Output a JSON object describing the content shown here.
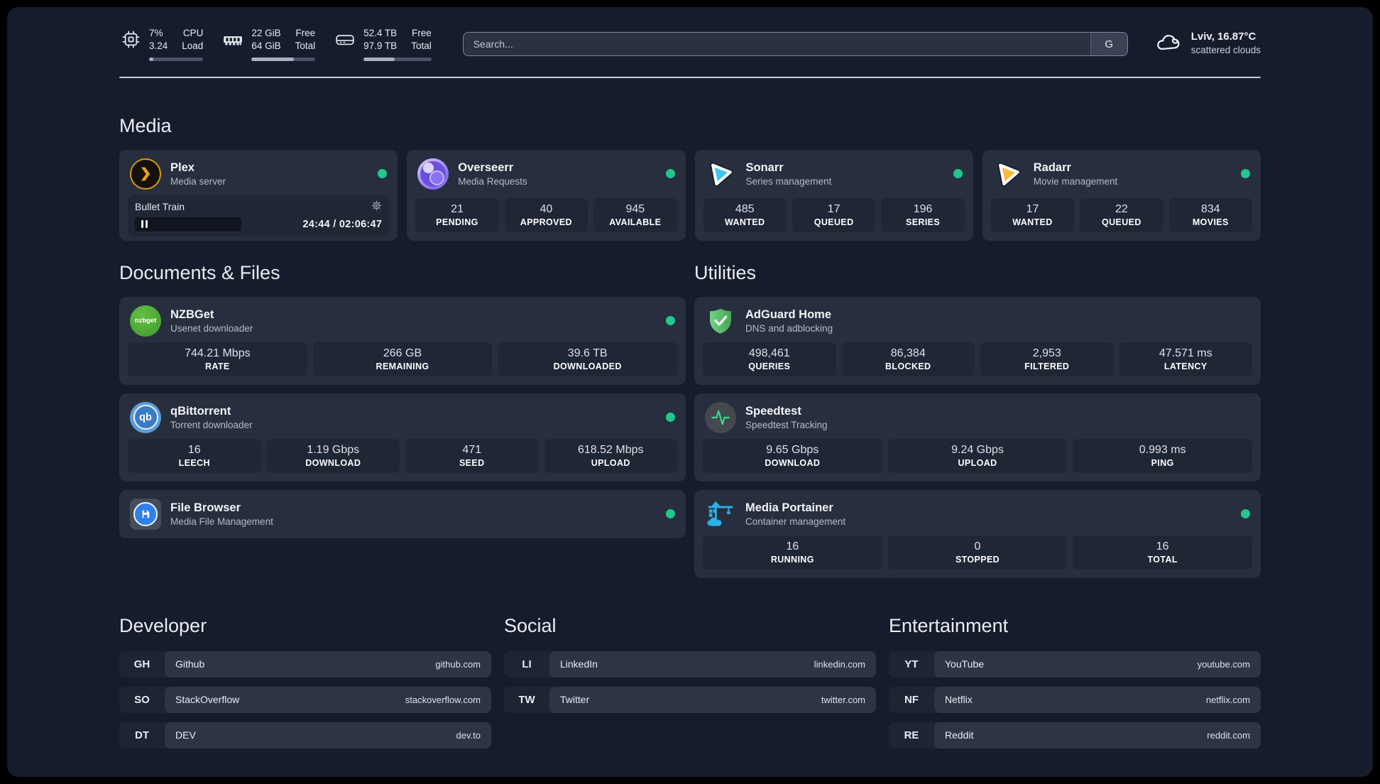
{
  "header": {
    "metrics": [
      {
        "icon": "cpu-chip-icon",
        "values": [
          "7%",
          "3.24"
        ],
        "labels": [
          "CPU",
          "Load"
        ],
        "progress_pct": 8
      },
      {
        "icon": "memory-icon",
        "values": [
          "22 GiB",
          "64 GiB"
        ],
        "labels": [
          "Free",
          "Total"
        ],
        "progress_pct": 66
      },
      {
        "icon": "hard-drive-icon",
        "values": [
          "52.4 TB",
          "97.9 TB"
        ],
        "labels": [
          "Free",
          "Total"
        ],
        "progress_pct": 46
      }
    ],
    "search": {
      "placeholder": "Search...",
      "engine_button": "G"
    },
    "weather": {
      "icon": "cloud-icon",
      "location": "Lviv, 16.87°C",
      "condition": "scattered clouds"
    }
  },
  "media": {
    "title": "Media",
    "cards": [
      {
        "title": "Plex",
        "subtitle": "Media server",
        "icon": "plex-icon",
        "online": true,
        "now_playing": {
          "title": "Bullet Train",
          "time": "24:44 / 02:06:47",
          "state": "paused"
        }
      },
      {
        "title": "Overseerr",
        "subtitle": "Media Requests",
        "icon": "overseerr-icon",
        "online": true,
        "stats": [
          {
            "value": "21",
            "label": "PENDING"
          },
          {
            "value": "40",
            "label": "APPROVED"
          },
          {
            "value": "945",
            "label": "AVAILABLE"
          }
        ]
      },
      {
        "title": "Sonarr",
        "subtitle": "Series management",
        "icon": "sonarr-icon",
        "online": true,
        "stats": [
          {
            "value": "485",
            "label": "WANTED"
          },
          {
            "value": "17",
            "label": "QUEUED"
          },
          {
            "value": "196",
            "label": "SERIES"
          }
        ]
      },
      {
        "title": "Radarr",
        "subtitle": "Movie management",
        "icon": "radarr-icon",
        "online": true,
        "stats": [
          {
            "value": "17",
            "label": "WANTED"
          },
          {
            "value": "22",
            "label": "QUEUED"
          },
          {
            "value": "834",
            "label": "MOVIES"
          }
        ]
      }
    ]
  },
  "documents": {
    "title": "Documents & Files",
    "cards": [
      {
        "title": "NZBGet",
        "subtitle": "Usenet downloader",
        "icon": "nzbget-icon",
        "online": true,
        "stats": [
          {
            "value": "744.21 Mbps",
            "label": "RATE"
          },
          {
            "value": "266 GB",
            "label": "REMAINING"
          },
          {
            "value": "39.6 TB",
            "label": "DOWNLOADED"
          }
        ]
      },
      {
        "title": "qBittorrent",
        "subtitle": "Torrent downloader",
        "icon": "qbittorrent-icon",
        "online": true,
        "stats": [
          {
            "value": "16",
            "label": "LEECH"
          },
          {
            "value": "1.19 Gbps",
            "label": "DOWNLOAD"
          },
          {
            "value": "471",
            "label": "SEED"
          },
          {
            "value": "618.52 Mbps",
            "label": "UPLOAD"
          }
        ]
      },
      {
        "title": "File Browser",
        "subtitle": "Media File Management",
        "icon": "filebrowser-icon",
        "online": true
      }
    ]
  },
  "utilities": {
    "title": "Utilities",
    "cards": [
      {
        "title": "AdGuard Home",
        "subtitle": "DNS and adblocking",
        "icon": "adguard-shield-icon",
        "online": false,
        "stats": [
          {
            "value": "498,461",
            "label": "QUERIES"
          },
          {
            "value": "86,384",
            "label": "BLOCKED"
          },
          {
            "value": "2,953",
            "label": "FILTERED"
          },
          {
            "value": "47.571 ms",
            "label": "LATENCY"
          }
        ]
      },
      {
        "title": "Speedtest",
        "subtitle": "Speedtest Tracking",
        "icon": "speedtest-pulse-icon",
        "online": false,
        "stats": [
          {
            "value": "9.65 Gbps",
            "label": "DOWNLOAD"
          },
          {
            "value": "9.24 Gbps",
            "label": "UPLOAD"
          },
          {
            "value": "0.993 ms",
            "label": "PING"
          }
        ]
      },
      {
        "title": "Media Portainer",
        "subtitle": "Container management",
        "icon": "portainer-crane-icon",
        "online": true,
        "stats": [
          {
            "value": "16",
            "label": "RUNNING"
          },
          {
            "value": "0",
            "label": "STOPPED"
          },
          {
            "value": "16",
            "label": "TOTAL"
          }
        ]
      }
    ]
  },
  "links": {
    "developer": {
      "title": "Developer",
      "items": [
        {
          "abbr": "GH",
          "name": "Github",
          "domain": "github.com"
        },
        {
          "abbr": "SO",
          "name": "StackOverflow",
          "domain": "stackoverflow.com"
        },
        {
          "abbr": "DT",
          "name": "DEV",
          "domain": "dev.to"
        }
      ]
    },
    "social": {
      "title": "Social",
      "items": [
        {
          "abbr": "LI",
          "name": "LinkedIn",
          "domain": "linkedin.com"
        },
        {
          "abbr": "TW",
          "name": "Twitter",
          "domain": "twitter.com"
        }
      ]
    },
    "entertainment": {
      "title": "Entertainment",
      "items": [
        {
          "abbr": "YT",
          "name": "YouTube",
          "domain": "youtube.com"
        },
        {
          "abbr": "NF",
          "name": "Netflix",
          "domain": "netflix.com"
        },
        {
          "abbr": "RE",
          "name": "Reddit",
          "domain": "reddit.com"
        }
      ]
    }
  },
  "icons": {
    "nzbget_logo_text": "nzbget",
    "qbittorrent_logo_text": "qb"
  },
  "colors": {
    "status_online": "#22c78e",
    "background": "#171c2c",
    "card": "#272e3d",
    "stat_box": "#1f2634",
    "plex_gold": "#e5a00d",
    "sonarr_blue": "#3cc5f4",
    "radarr_orange": "#ffb83d"
  }
}
